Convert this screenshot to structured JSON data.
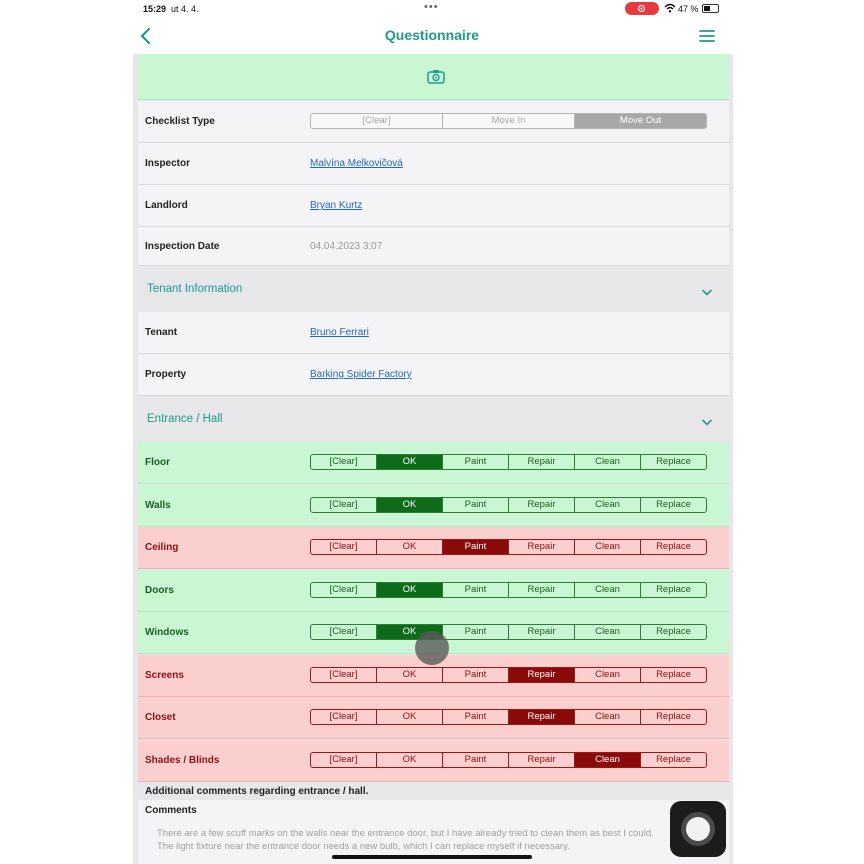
{
  "status_bar": {
    "time": "15:29",
    "date": "ut 4. 4.",
    "dots": "•••",
    "battery": "47 %"
  },
  "nav": {
    "title": "Questionnaire"
  },
  "fields": [
    {
      "label": "Checklist Type",
      "type": "segment",
      "options": [
        "[Clear]",
        "Move In",
        "Move Out"
      ],
      "selected": 2
    },
    {
      "label": "Inspector",
      "value": "Malvína Melkovičová",
      "link": true
    },
    {
      "label": "Landlord",
      "value": "Bryan Kurtz",
      "link": true
    },
    {
      "label": "Inspection Date",
      "value": "04.04.2023 3:07",
      "link": false
    }
  ],
  "tenant_section": {
    "title": "Tenant Information",
    "fields": [
      {
        "label": "Tenant",
        "value": "Bruno Ferrari"
      },
      {
        "label": "Property",
        "value": "Barking Spider Factory"
      }
    ]
  },
  "entrance_section": {
    "title": "Entrance / Hall",
    "options": [
      "[Clear]",
      "OK",
      "Paint",
      "Repair",
      "Clean",
      "Replace"
    ],
    "items": [
      {
        "label": "Floor",
        "status": "green",
        "selected": 1
      },
      {
        "label": "Walls",
        "status": "green",
        "selected": 1
      },
      {
        "label": "Ceiling",
        "status": "red",
        "selected": 2
      },
      {
        "label": "Doors",
        "status": "green",
        "selected": 1
      },
      {
        "label": "Windows",
        "status": "green",
        "selected": 1
      },
      {
        "label": "Screens",
        "status": "red",
        "selected": 3
      },
      {
        "label": "Closet",
        "status": "red",
        "selected": 3
      },
      {
        "label": "Shades / Blinds",
        "status": "red",
        "selected": 4
      }
    ]
  },
  "comments": {
    "heading": "Additional comments regarding entrance / hall.",
    "label": "Comments",
    "text_line1": "There are a few scuff marks on the walls near the entrance door, but I have already tried to clean them as best I could.",
    "text_line2": "The light fixture near the entrance door needs a new bulb, which I can replace myself if necessary."
  },
  "colors": {
    "accent": "#1f9a8c",
    "ok_green": "#c9f7d3",
    "issue_red": "#fbcfcd"
  }
}
